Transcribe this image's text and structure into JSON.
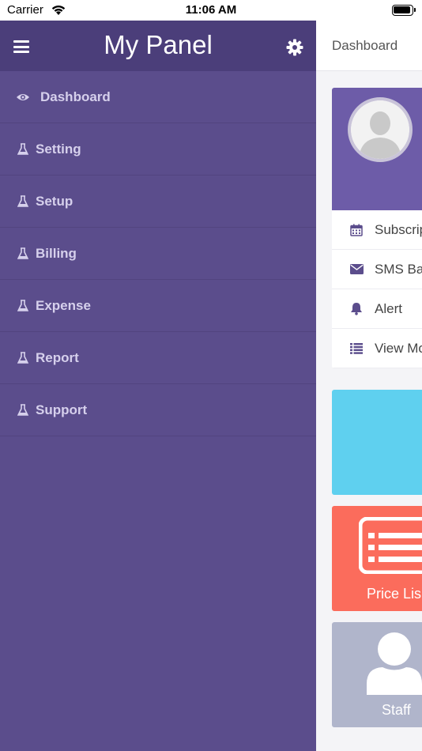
{
  "status_bar": {
    "carrier": "Carrier",
    "time": "11:06 AM"
  },
  "sidebar": {
    "title": "My Panel",
    "items": [
      {
        "label": "Dashboard",
        "icon": "eye-icon"
      },
      {
        "label": "Setting",
        "icon": "flask-icon"
      },
      {
        "label": "Setup",
        "icon": "flask-icon"
      },
      {
        "label": "Billing",
        "icon": "flask-icon"
      },
      {
        "label": "Expense",
        "icon": "flask-icon"
      },
      {
        "label": "Report",
        "icon": "flask-icon"
      },
      {
        "label": "Support",
        "icon": "flask-icon"
      }
    ]
  },
  "main": {
    "title": "Dashboard",
    "profile_rows": [
      {
        "label": "Subscrip",
        "icon": "calendar-icon"
      },
      {
        "label": "SMS Ba",
        "icon": "envelope-icon"
      },
      {
        "label": "Alert",
        "icon": "bell-icon"
      },
      {
        "label": "View Mo",
        "icon": "list-icon"
      }
    ],
    "tiles": [
      {
        "label": "",
        "color": "#5fd0ef"
      },
      {
        "label": "Price Lis",
        "color": "#fb6c5c",
        "icon": "price-list-icon"
      },
      {
        "label": "Staff",
        "color": "#b0b5cb",
        "icon": "user-icon"
      }
    ]
  },
  "colors": {
    "sidebar_bg": "#5b4d8c",
    "sidebar_header_bg": "#4b3e7a",
    "profile_header_bg": "#6d5ca8",
    "icon_purple": "#5b4d8c"
  }
}
